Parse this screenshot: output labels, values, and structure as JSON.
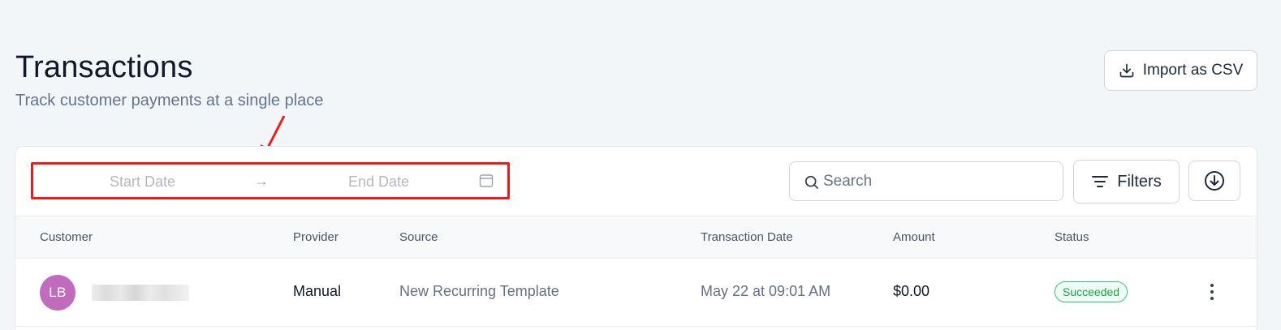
{
  "header": {
    "title": "Transactions",
    "subtitle": "Track customer payments at a single place",
    "import_label": "Import as CSV"
  },
  "toolbar": {
    "start_date_placeholder": "Start Date",
    "end_date_placeholder": "End Date",
    "arrow_glyph": "→",
    "search_placeholder": "Search",
    "filters_label": "Filters"
  },
  "table": {
    "columns": [
      "Customer",
      "Provider",
      "Source",
      "Transaction Date",
      "Amount",
      "Status"
    ],
    "rows": [
      {
        "initials": "LB",
        "provider": "Manual",
        "source": "New Recurring Template",
        "date": "May 22 at 09:01 AM",
        "amount": "$0.00",
        "status": "Succeeded"
      }
    ]
  },
  "colors": {
    "highlight_box": "#ee1b1b",
    "avatar": "#c16bbd",
    "status_success": "#16a34a"
  }
}
